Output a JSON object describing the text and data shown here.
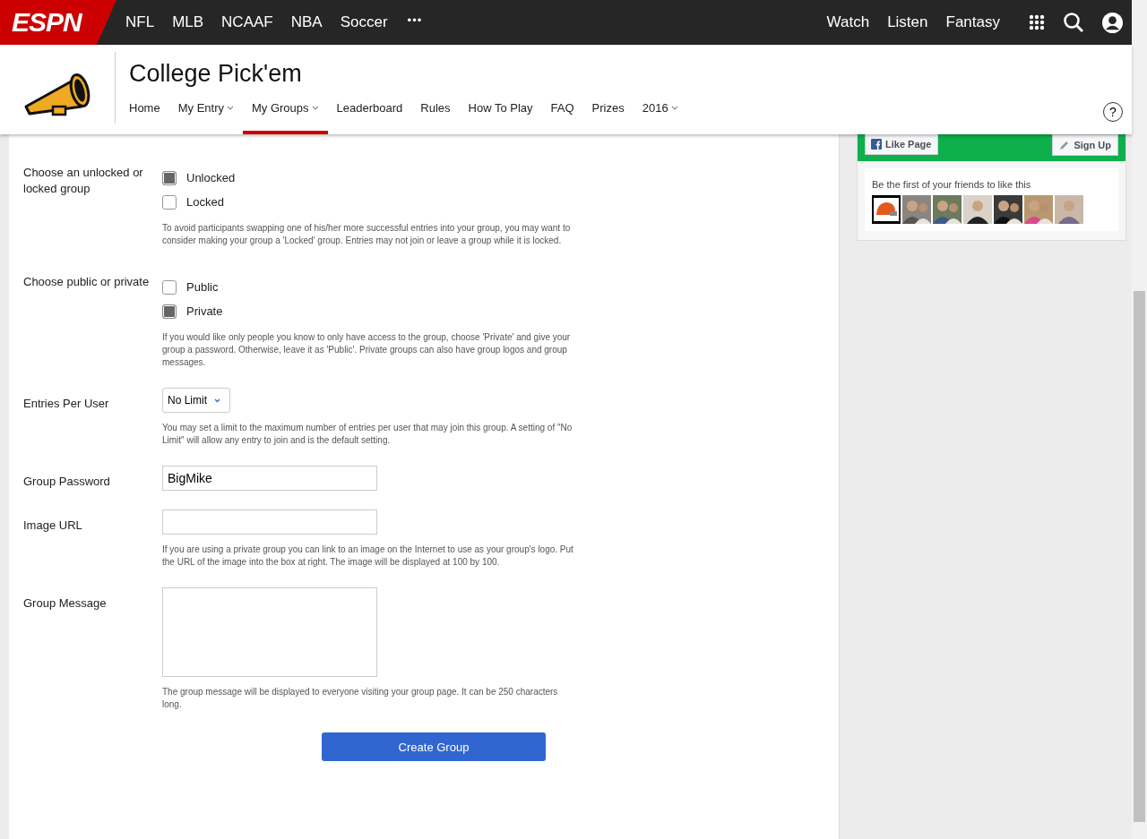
{
  "topbar": {
    "logo": "ESPN",
    "sports": [
      "NFL",
      "MLB",
      "NCAAF",
      "NBA",
      "Soccer"
    ],
    "more": "•••",
    "links": [
      "Watch",
      "Listen",
      "Fantasy"
    ]
  },
  "header": {
    "title": "College Pick'em",
    "help": "?",
    "nav": [
      {
        "label": "Home",
        "dropdown": false,
        "selected": false
      },
      {
        "label": "My Entry",
        "dropdown": true,
        "selected": false
      },
      {
        "label": "My Groups",
        "dropdown": true,
        "selected": true
      },
      {
        "label": "Leaderboard",
        "dropdown": false,
        "selected": false
      },
      {
        "label": "Rules",
        "dropdown": false,
        "selected": false
      },
      {
        "label": "How To Play",
        "dropdown": false,
        "selected": false
      },
      {
        "label": "FAQ",
        "dropdown": false,
        "selected": false
      },
      {
        "label": "Prizes",
        "dropdown": false,
        "selected": false
      },
      {
        "label": "2016",
        "dropdown": true,
        "selected": false
      }
    ]
  },
  "form": {
    "rows": [
      {
        "kind": "options",
        "label": "Choose an unlocked or locked group",
        "options": [
          {
            "label": "Unlocked",
            "selected": true
          },
          {
            "label": "Locked",
            "selected": false
          }
        ],
        "help": "To avoid participants swapping one of his/her more successful entries into your group, you may want to consider making your group a 'Locked' group. Entries may not join or leave a group while it is locked."
      },
      {
        "kind": "options",
        "label": "Choose public or private",
        "options": [
          {
            "label": "Public",
            "selected": false
          },
          {
            "label": "Private",
            "selected": true
          }
        ],
        "help": "If you would like only people you know to only have access to the group, choose 'Private' and give your group a password. Otherwise, leave it as 'Public'. Private groups can also have group logos and group messages."
      },
      {
        "kind": "select",
        "label": "Entries Per User",
        "value": "No Limit",
        "help": "You may set a limit to the maximum number of entries per user that may join this group. A setting of \"No Limit\" will allow any entry to join and is the default setting."
      },
      {
        "kind": "input",
        "label": "Group Password",
        "value": "BigMike"
      },
      {
        "kind": "input",
        "label": "Image URL",
        "help": "If you are using a private group you can link to an image on the Internet to use as your group's logo. Put the URL of the image into the box at right. The image will be displayed at 100 by 100."
      },
      {
        "kind": "textarea",
        "label": "Group Message",
        "help": "The group message will be displayed to everyone visiting your group page. It can be 250 characters long."
      }
    ],
    "submit": "Create Group"
  },
  "facebook": {
    "like": "Like Page",
    "signup": "Sign Up",
    "friends_text": "Be the first of your friends to like this"
  }
}
